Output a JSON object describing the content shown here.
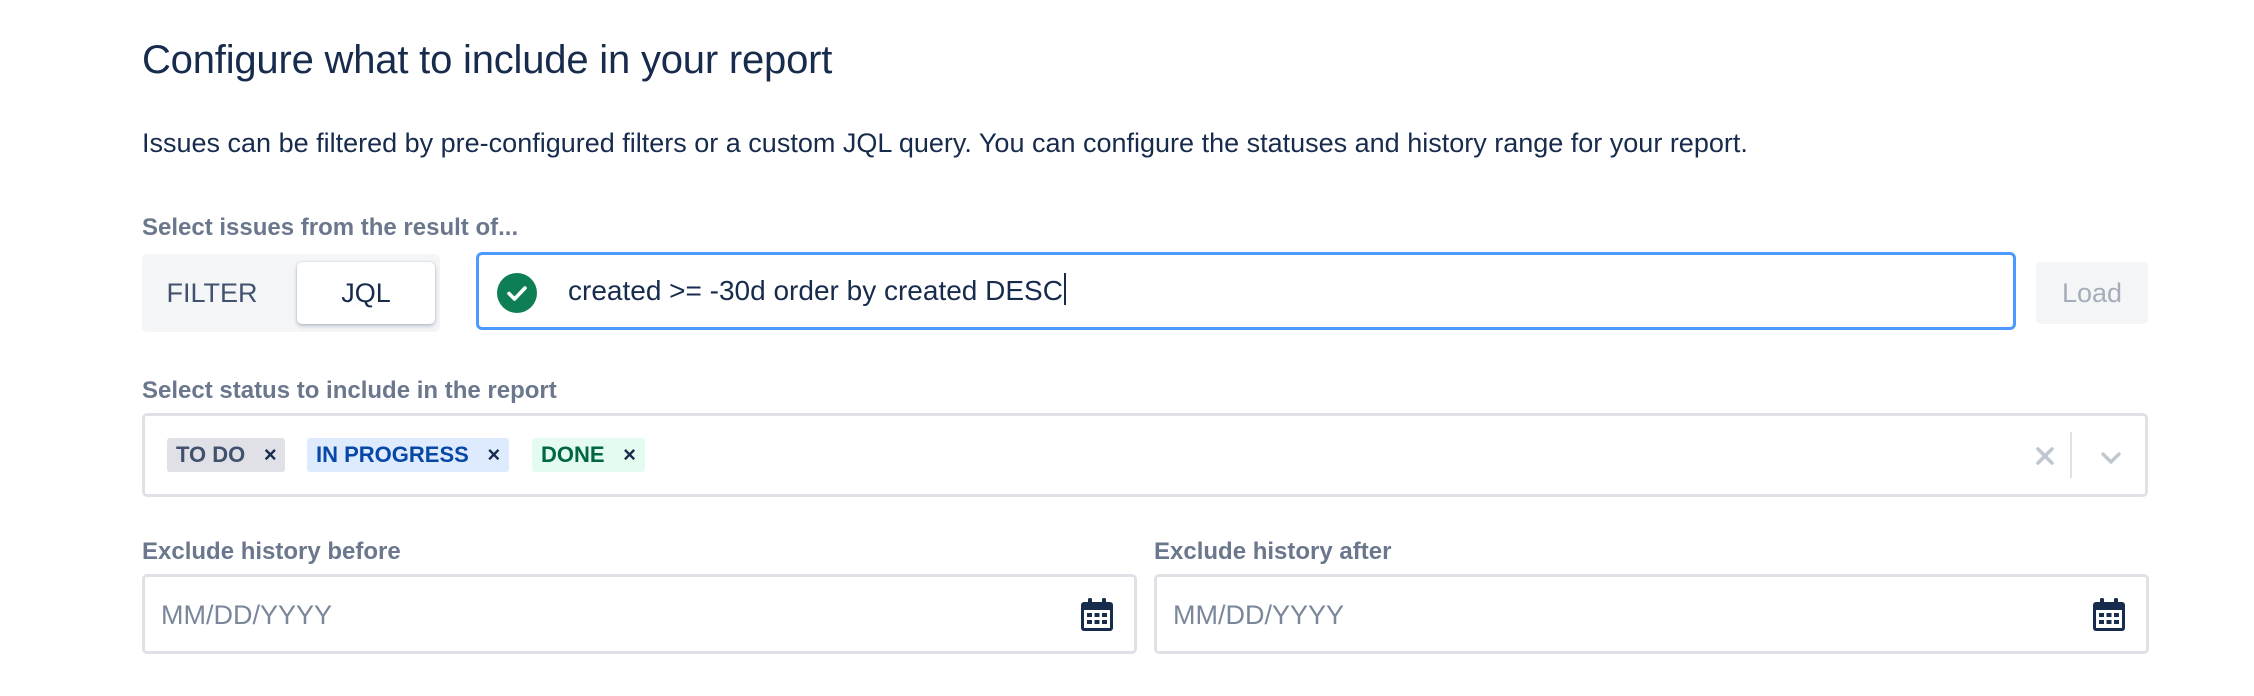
{
  "header": {
    "title": "Configure what to include in your report",
    "description": "Issues can be filtered by pre-configured filters or a custom JQL query. You can configure the statuses and history range for your report."
  },
  "source": {
    "label": "Select issues from the result of...",
    "toggle": {
      "filter_label": "FILTER",
      "jql_label": "JQL",
      "selected": "JQL"
    },
    "jql_query": "created >= -30d order by created DESC",
    "query_status_icon": "check-circle-icon",
    "load_label": "Load"
  },
  "status": {
    "label": "Select status to include in the report",
    "tags": [
      {
        "label": "TO DO",
        "remove": "×"
      },
      {
        "label": "IN PROGRESS",
        "remove": "×"
      },
      {
        "label": "DONE",
        "remove": "×"
      }
    ]
  },
  "history": {
    "before": {
      "label": "Exclude history before",
      "placeholder": "MM/DD/YYYY"
    },
    "after": {
      "label": "Exclude history after",
      "placeholder": "MM/DD/YYYY"
    }
  },
  "colors": {
    "focus_border": "#4c9aff",
    "valid_green": "#0e7f55",
    "todo_bg": "#dfe1e6",
    "in_progress_bg": "#deebff",
    "in_progress_text": "#0747a6",
    "done_bg": "#e3fcef",
    "done_text": "#006644"
  }
}
